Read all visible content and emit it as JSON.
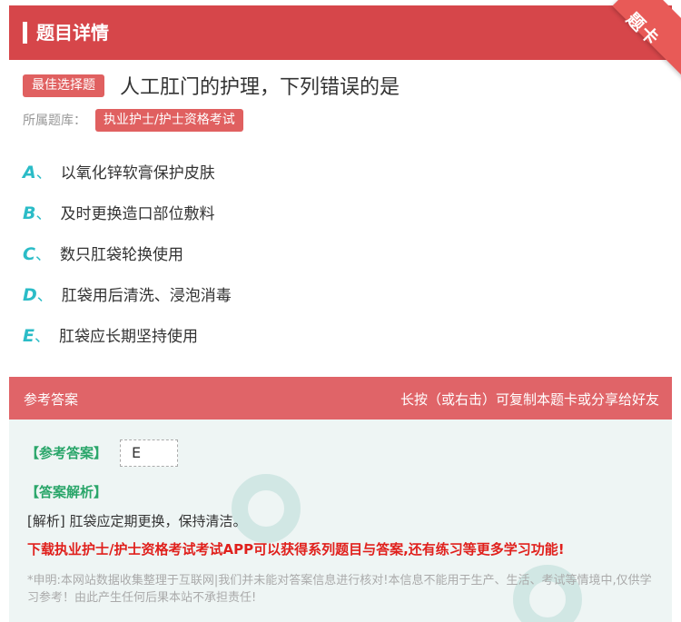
{
  "header": {
    "title": "题目详情",
    "corner_label": "题卡"
  },
  "question": {
    "type_badge": "最佳选择题",
    "text": "人工肛门的护理，下列错误的是",
    "library_label": "所属题库：",
    "library_value": "执业护士/护士资格考试"
  },
  "options": [
    {
      "letter": "A",
      "sep": "、",
      "text": "以氧化锌软膏保护皮肤"
    },
    {
      "letter": "B",
      "sep": "、",
      "text": "及时更换造口部位敷料"
    },
    {
      "letter": "C",
      "sep": "、",
      "text": "数只肛袋轮换使用"
    },
    {
      "letter": "D",
      "sep": "、",
      "text": "肛袋用后清洗、浸泡消毒"
    },
    {
      "letter": "E",
      "sep": "、",
      "text": "肛袋应长期坚持使用"
    }
  ],
  "answer": {
    "section_title": "参考答案",
    "hint": "长按（或右击）可复制本题卡或分享给好友",
    "ref_label": "【参考答案】",
    "ref_value": "E",
    "exp_label": "【答案解析】",
    "exp_text": "[解析] 肛袋应定期更换，保持清洁。",
    "promo": "下载执业护士/护士资格考试考试APP可以获得系列题目与答案,还有练习等更多学习功能!",
    "disclaimer": "*申明:本网站数据收集整理于互联网|我们并未能对答案信息进行核对!本信息不能用于生产、生活、考试等情境中,仅供学习参考！由此产生任何后果本站不承担责任!"
  }
}
